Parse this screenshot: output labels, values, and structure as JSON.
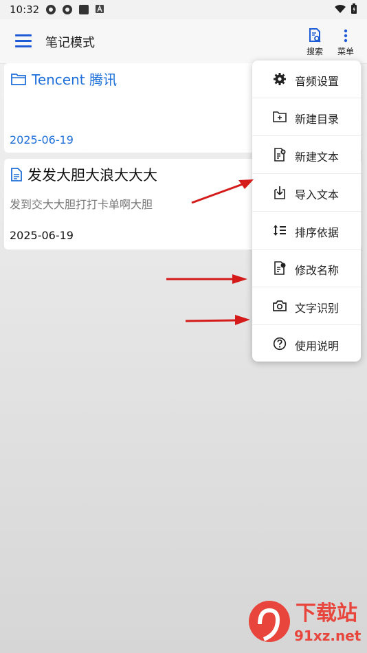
{
  "status_bar": {
    "time": "10:32"
  },
  "app_bar": {
    "title": "笔记模式",
    "search_label": "搜索",
    "menu_label": "菜单",
    "accent_color": "#1e5bd7"
  },
  "notes": [
    {
      "type": "folder",
      "title": "Tencent 腾讯",
      "date": "2025-06-19"
    },
    {
      "type": "document",
      "title": "发发大胆大浪大大大",
      "snippet": "发到交大大胆打打卡单啊大胆",
      "date": "2025-06-19"
    }
  ],
  "menu": {
    "items": [
      {
        "label": "音频设置",
        "icon": "gear-icon"
      },
      {
        "label": "新建目录",
        "icon": "new-folder-icon"
      },
      {
        "label": "新建文本",
        "icon": "new-document-icon"
      },
      {
        "label": "导入文本",
        "icon": "import-icon"
      },
      {
        "label": "排序依据",
        "icon": "sort-icon"
      },
      {
        "label": "修改名称",
        "icon": "rename-icon"
      },
      {
        "label": "文字识别",
        "icon": "camera-icon"
      },
      {
        "label": "使用说明",
        "icon": "help-icon"
      }
    ]
  },
  "watermark": {
    "text": "下载站",
    "url_text": "91xz.net"
  }
}
